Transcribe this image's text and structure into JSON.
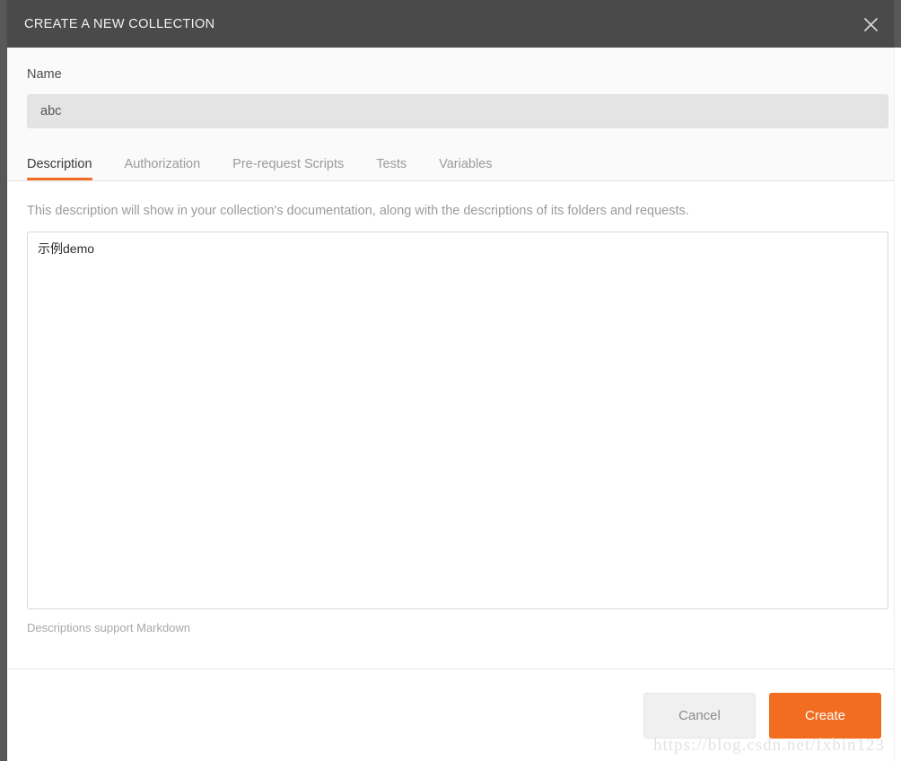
{
  "dialog": {
    "title": "CREATE A NEW COLLECTION",
    "close_icon": "close-icon"
  },
  "name_section": {
    "label": "Name",
    "value": "abc",
    "placeholder": "Name"
  },
  "tabs": [
    {
      "label": "Description",
      "active": true
    },
    {
      "label": "Authorization",
      "active": false
    },
    {
      "label": "Pre-request Scripts",
      "active": false
    },
    {
      "label": "Tests",
      "active": false
    },
    {
      "label": "Variables",
      "active": false
    }
  ],
  "description_panel": {
    "hint": "This description will show in your collection's documentation, along with the descriptions of its folders and requests.",
    "textarea_value": "示例demo",
    "textarea_placeholder": "",
    "footnote": "Descriptions support Markdown"
  },
  "footer": {
    "cancel_label": "Cancel",
    "create_label": "Create"
  },
  "watermark": {
    "text": "https://blog.csdn.net/fxbin123"
  },
  "colors": {
    "header_bg": "#4a4a4a",
    "accent": "#f26c21",
    "upper_bg": "#fafafa",
    "input_bg": "#e4e4e4",
    "cancel_bg": "#f0f0f0",
    "muted_text": "#9b9b9b"
  }
}
